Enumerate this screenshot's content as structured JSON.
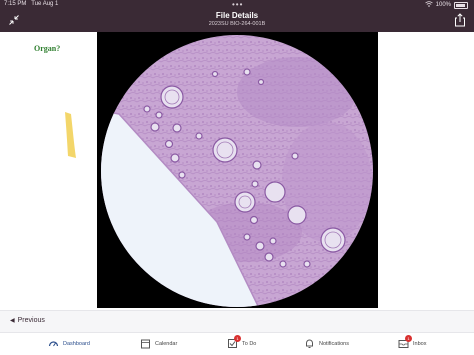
{
  "status_bar": {
    "time": "7:15 PM",
    "date": "Tue Aug 1",
    "battery": "100%"
  },
  "header": {
    "title": "File Details",
    "subtitle": "2023SU BIO-264-001B"
  },
  "document": {
    "question": "Organ?"
  },
  "navigation": {
    "previous_label": "Previous"
  },
  "tabs": [
    {
      "label": "Dashboard",
      "icon": "dashboard-icon",
      "active": true
    },
    {
      "label": "Calendar",
      "icon": "calendar-icon",
      "active": false
    },
    {
      "label": "To Do",
      "icon": "todo-icon",
      "active": false,
      "badge": "1"
    },
    {
      "label": "Notifications",
      "icon": "bell-icon",
      "active": false
    },
    {
      "label": "Inbox",
      "icon": "inbox-icon",
      "active": false,
      "badge": "1"
    }
  ],
  "colors": {
    "header_bg": "#3a2a35",
    "active_tab": "#2b4e8c",
    "badge": "#d9302f",
    "question_text": "#2f7f2f",
    "highlight": "#f2d15a",
    "tissue_stain": "#c9a5d4"
  }
}
